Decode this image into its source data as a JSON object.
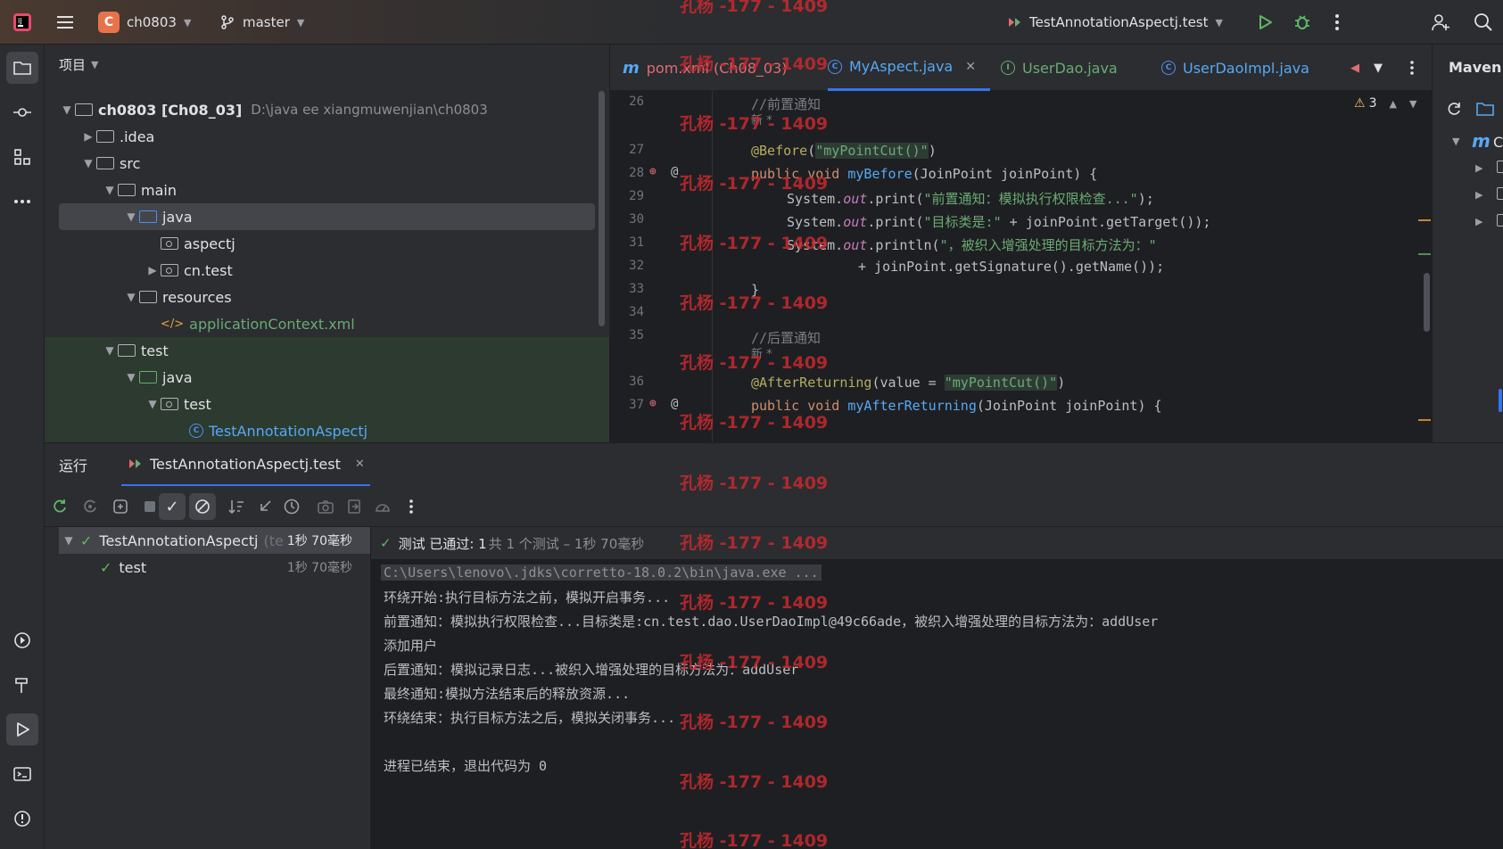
{
  "titlebar": {
    "project_badge": "C",
    "project_name": "ch0803",
    "branch": "master",
    "run_config": "TestAnnotationAspectj.test"
  },
  "project_panel": {
    "title": "项目",
    "tree": [
      {
        "label": "ch0803 [Ch08_03]",
        "path": "D:\\java ee xiangmuwenjian\\ch0803"
      },
      {
        "label": ".idea"
      },
      {
        "label": "src"
      },
      {
        "label": "main"
      },
      {
        "label": "java"
      },
      {
        "label": "aspectj"
      },
      {
        "label": "cn.test"
      },
      {
        "label": "resources"
      },
      {
        "label": "applicationContext.xml"
      },
      {
        "label": "test"
      },
      {
        "label": "java"
      },
      {
        "label": "test"
      },
      {
        "label": "TestAnnotationAspectj"
      }
    ]
  },
  "editor": {
    "tabs": [
      {
        "label": "pom.xml (Ch08_03)"
      },
      {
        "label": "MyAspect.java"
      },
      {
        "label": "UserDao.java"
      },
      {
        "label": "UserDaoImpl.java"
      }
    ],
    "warning_count": "3",
    "lines": {
      "l26_no": "26",
      "l26_comment": "//前置通知",
      "l26_hint": "新 *",
      "l27_no": "27",
      "l27_ann": "@Before",
      "l27_str": "\"myPointCut()\"",
      "l28_no": "28",
      "l28_kw": "public void ",
      "l28_fn": "myBefore",
      "l28_rest": "(JoinPoint joinPoint) {",
      "l29_no": "29",
      "l29_a": "System.",
      "l29_it": "out",
      "l29_b": ".print(",
      "l29_str": "\"前置通知：模拟执行权限检查...\"",
      "l29_c": ");",
      "l30_no": "30",
      "l30_a": "System.",
      "l30_it": "out",
      "l30_b": ".print(",
      "l30_str": "\"目标类是:\"",
      "l30_c": " + joinPoint.getTarget());",
      "l31_no": "31",
      "l31_a": "System.",
      "l31_it": "out",
      "l31_b": ".println(",
      "l31_str": "\"，被织入增强处理的目标方法为：\"",
      "l32_no": "32",
      "l32_code": "+ joinPoint.getSignature().getName());",
      "l33_no": "33",
      "l33_code": "}",
      "l34_no": "34",
      "l35_no": "35",
      "l35_comment": "//后置通知",
      "l35_hint": "新 *",
      "l36_no": "36",
      "l36_ann": "@AfterReturning",
      "l36_a": "(value = ",
      "l36_str": "\"myPointCut()\"",
      "l36_b": ")",
      "l37_no": "37",
      "l37_kw": "public void ",
      "l37_fn": "myAfterReturning",
      "l37_rest": "(JoinPoint joinPoint) {"
    }
  },
  "maven": {
    "title": "Maven",
    "root_letter": "C"
  },
  "run_panel": {
    "tab_run": "运行",
    "tab_config": "TestAnnotationAspectj.test",
    "tests": [
      {
        "label": "TestAnnotationAspectj",
        "suffix": "(te",
        "duration": "1秒 70毫秒"
      },
      {
        "label": "test",
        "duration": "1秒 70毫秒"
      }
    ],
    "status_pass": "测试 已通过: 1",
    "status_detail": "共 1 个测试 – 1秒 70毫秒",
    "console": [
      "C:\\Users\\lenovo\\.jdks\\corretto-18.0.2\\bin\\java.exe ...",
      "环绕开始:执行目标方法之前，模拟开启事务...",
      "前置通知：模拟执行权限检查...目标类是:cn.test.dao.UserDaoImpl@49c66ade，被织入增强处理的目标方法为：addUser",
      "添加用户",
      "后置通知：模拟记录日志...被织入增强处理的目标方法为：addUser",
      "最终通知:模拟方法结束后的释放资源...",
      "环绕结束：执行目标方法之后，模拟关闭事务...",
      "",
      "进程已结束，退出代码为 0"
    ]
  },
  "watermark": "孔杨 -177 - 1409",
  "colors": {
    "accent": "#3574f0",
    "pass": "#5fb865",
    "watermark": "#c8292e"
  }
}
